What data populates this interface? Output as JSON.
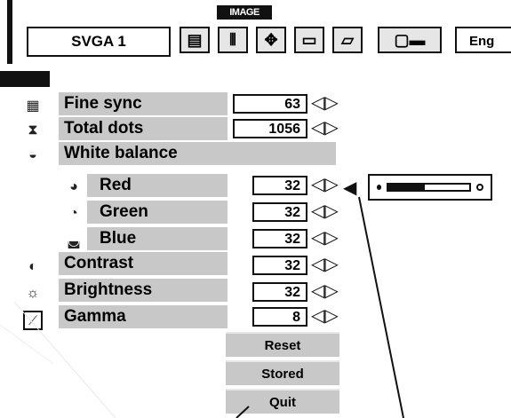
{
  "header": {
    "title": "IMAGE"
  },
  "toolbar": {
    "mode_value": "SVGA 1",
    "language_value": "Eng"
  },
  "rows": {
    "fine_sync": {
      "label": "Fine sync",
      "value": "63"
    },
    "total_dots": {
      "label": "Total dots",
      "value": "1056"
    },
    "white_balance": {
      "label": "White balance"
    },
    "red": {
      "label": "Red",
      "value": "32"
    },
    "green": {
      "label": "Green",
      "value": "32"
    },
    "blue": {
      "label": "Blue",
      "value": "32"
    },
    "contrast": {
      "label": "Contrast",
      "value": "32"
    },
    "brightness": {
      "label": "Brightness",
      "value": "32"
    },
    "gamma": {
      "label": "Gamma",
      "value": "8"
    }
  },
  "slider_popup": {
    "level_fraction": 0.45
  },
  "buttons": {
    "reset": "Reset",
    "stored": "Stored",
    "quit": "Quit"
  },
  "icons": {
    "fine_sync": "fine-sync-icon",
    "total_dots": "total-dots-icon",
    "white_balance": "white-balance-icon",
    "red": "red-icon",
    "green": "green-icon",
    "blue": "blue-icon",
    "contrast": "contrast-icon",
    "brightness": "brightness-icon",
    "gamma": "gamma-icon"
  }
}
